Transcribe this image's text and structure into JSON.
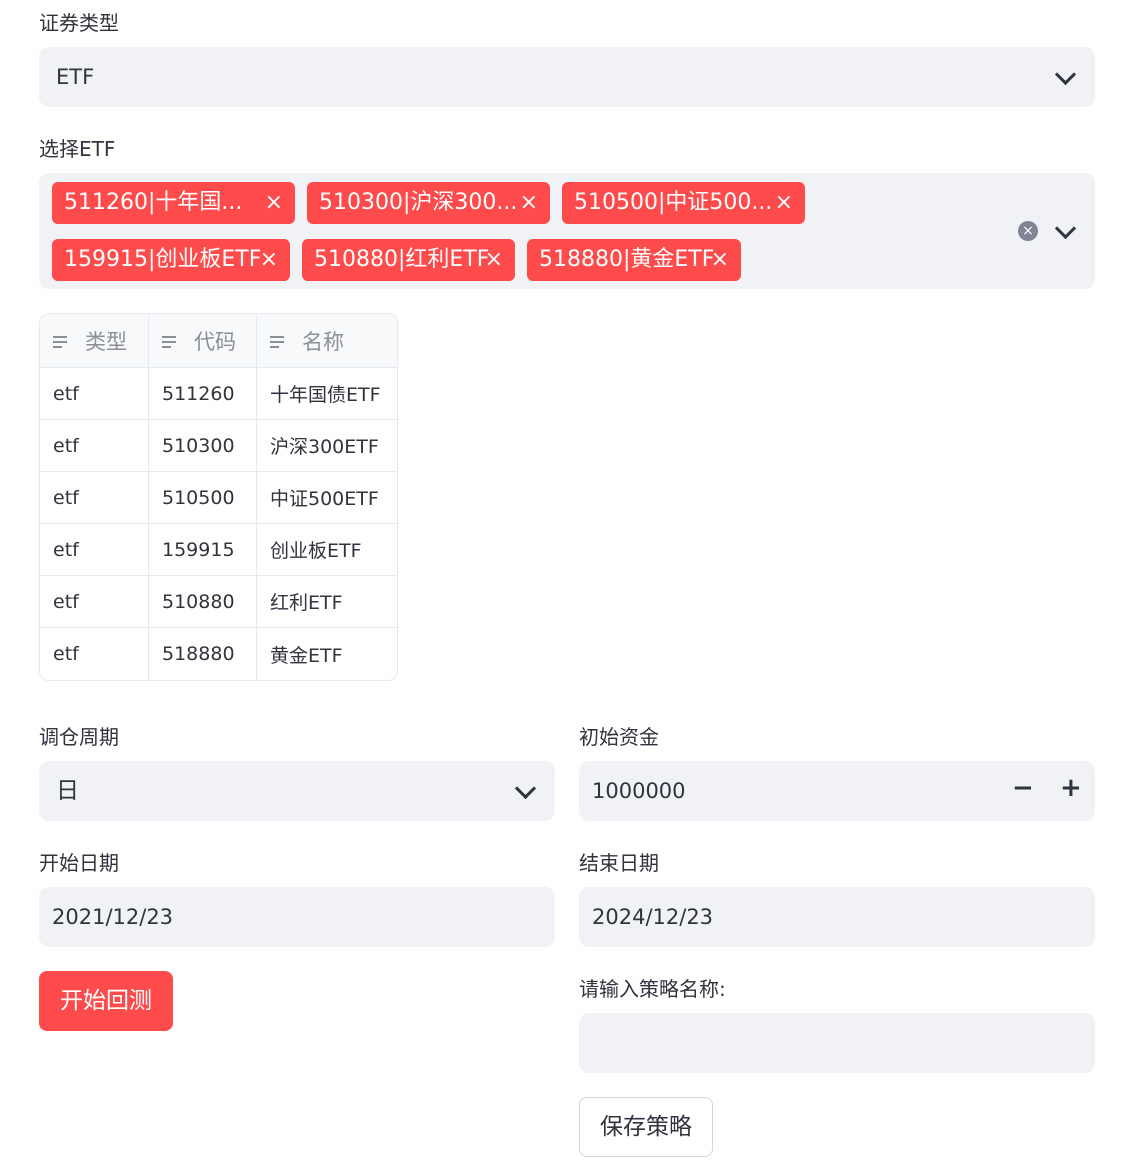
{
  "security_type": {
    "label": "证券类型",
    "value": "ETF"
  },
  "etf_select": {
    "label": "选择ETF",
    "tags": [
      "511260|十年国...",
      "510300|沪深300...",
      "510500|中证500...",
      "159915|创业板ETF",
      "510880|红利ETF",
      "518880|黄金ETF"
    ]
  },
  "table": {
    "headers": [
      "类型",
      "代码",
      "名称"
    ],
    "rows": [
      [
        "etf",
        "511260",
        "十年国债ETF"
      ],
      [
        "etf",
        "510300",
        "沪深300ETF"
      ],
      [
        "etf",
        "510500",
        "中证500ETF"
      ],
      [
        "etf",
        "159915",
        "创业板ETF"
      ],
      [
        "etf",
        "510880",
        "红利ETF"
      ],
      [
        "etf",
        "518880",
        "黄金ETF"
      ]
    ]
  },
  "rebalance": {
    "label": "调仓周期",
    "value": "日"
  },
  "capital": {
    "label": "初始资金",
    "value": "1000000",
    "minus": "−",
    "plus": "+"
  },
  "start_date": {
    "label": "开始日期",
    "value": "2021/12/23"
  },
  "end_date": {
    "label": "结束日期",
    "value": "2024/12/23"
  },
  "run_button": "开始回测",
  "strategy_name": {
    "label": "请输入策略名称:",
    "value": ""
  },
  "save_button": "保存策略",
  "icons": {
    "tag_remove": "×",
    "clear_all": "×"
  },
  "colors": {
    "accent": "#ff4b4b",
    "field_bg": "#f0f2f6"
  }
}
